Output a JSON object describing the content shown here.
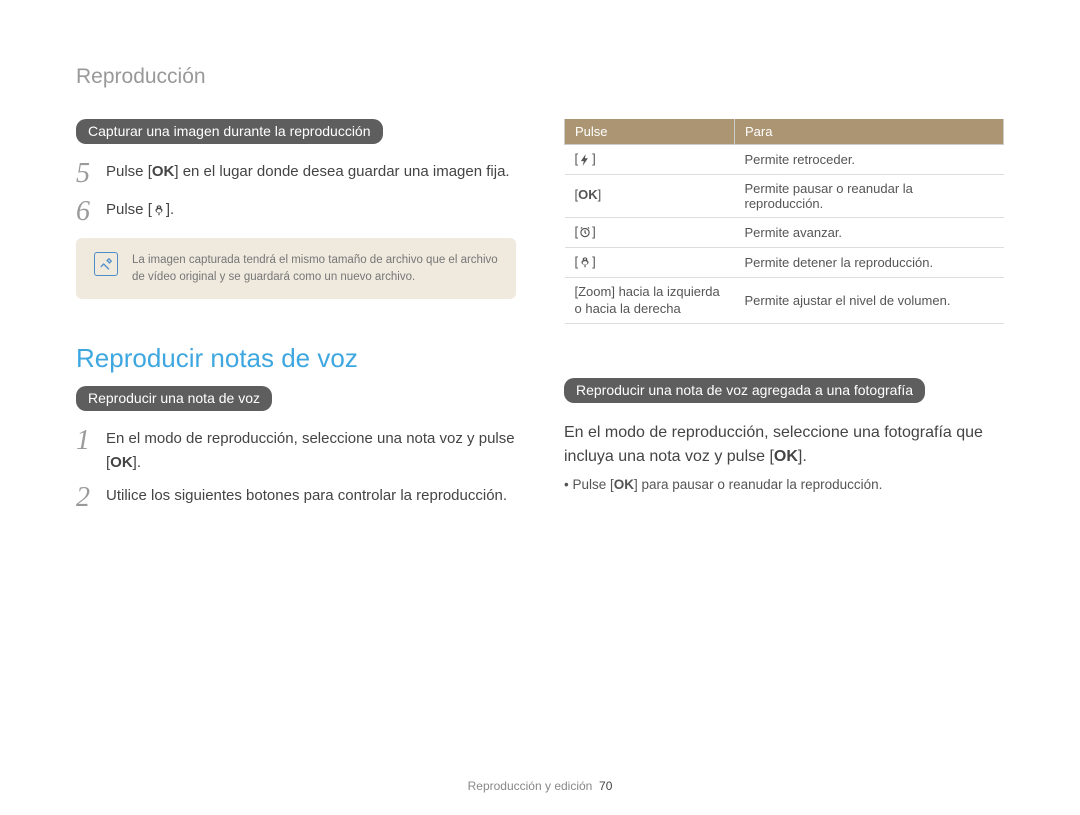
{
  "breadcrumb": "Reproducción",
  "left": {
    "pill1": "Capturar una imagen durante la reproducción",
    "step5_pre": "Pulse [",
    "step5_ok": "OK",
    "step5_post": "] en el lugar donde desea guardar una imagen fija.",
    "step6_text": "Pulse [",
    "step6_post": "].",
    "note": "La imagen capturada tendrá el mismo tamaño de archivo que el archivo de vídeo original y se guardará como un nuevo archivo.",
    "section_title": "Reproducir notas de voz",
    "pill2": "Reproducir una nota de voz",
    "p1_pre": "En el modo de reproducción, seleccione una nota voz y pulse [",
    "p1_ok": "OK",
    "p1_post": "].",
    "p2": "Utilice los siguientes botones para controlar la reproducción."
  },
  "step_nums": {
    "five": "5",
    "six": "6",
    "one": "1",
    "two": "2"
  },
  "table": {
    "h1": "Pulse",
    "h2": "Para",
    "rows": [
      {
        "key_type": "icon",
        "key": "flash",
        "val": "Permite retroceder."
      },
      {
        "key_type": "ok",
        "key": "OK",
        "val": "Permite pausar o reanudar la reproducción."
      },
      {
        "key_type": "icon",
        "key": "timer",
        "val": "Permite avanzar."
      },
      {
        "key_type": "icon",
        "key": "macro",
        "val": "Permite detener la reproducción."
      },
      {
        "key_type": "text",
        "key": "[Zoom] hacia la izquierda o hacia la derecha",
        "val": "Permite ajustar el nivel de volumen."
      }
    ]
  },
  "right": {
    "pill": "Reproducir una nota de voz agregada a una fotografía",
    "para_pre": "En el modo de reproducción, seleccione una fotografía que incluya una nota voz y pulse [",
    "para_ok": "OK",
    "para_post": "].",
    "bullet_pre": "Pulse [",
    "bullet_ok": "OK",
    "bullet_post": "] para pausar o reanudar la reproducción."
  },
  "footer": {
    "text": "Reproducción y edición",
    "page": "70"
  }
}
